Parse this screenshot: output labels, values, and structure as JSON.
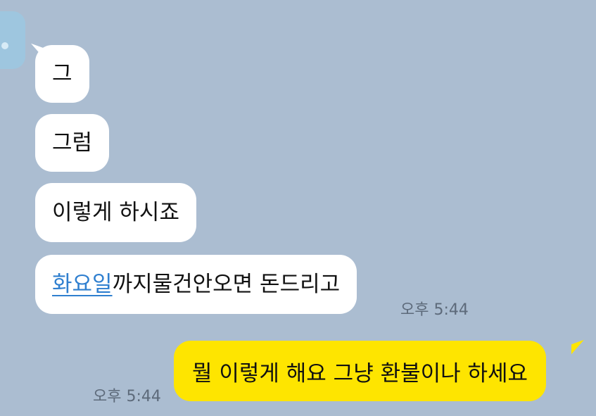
{
  "chat": {
    "received": [
      {
        "text": "그"
      },
      {
        "text": "그럼"
      },
      {
        "text": "이렇게 하시죠"
      },
      {
        "link_text": "화요일",
        "rest_text": "까지물건안오면 돈드리고",
        "time": "오후 5:44"
      }
    ],
    "sent": [
      {
        "text": "뭘 이렇게 해요 그냥 환불이나 하세요",
        "time": "오후 5:44"
      }
    ]
  },
  "colors": {
    "background": "#abbdd1",
    "received_bubble": "#ffffff",
    "sent_bubble": "#fee500",
    "link": "#2f7fcf",
    "timestamp": "#5d6a7a"
  },
  "icons": {
    "avatar": "profile-avatar"
  }
}
